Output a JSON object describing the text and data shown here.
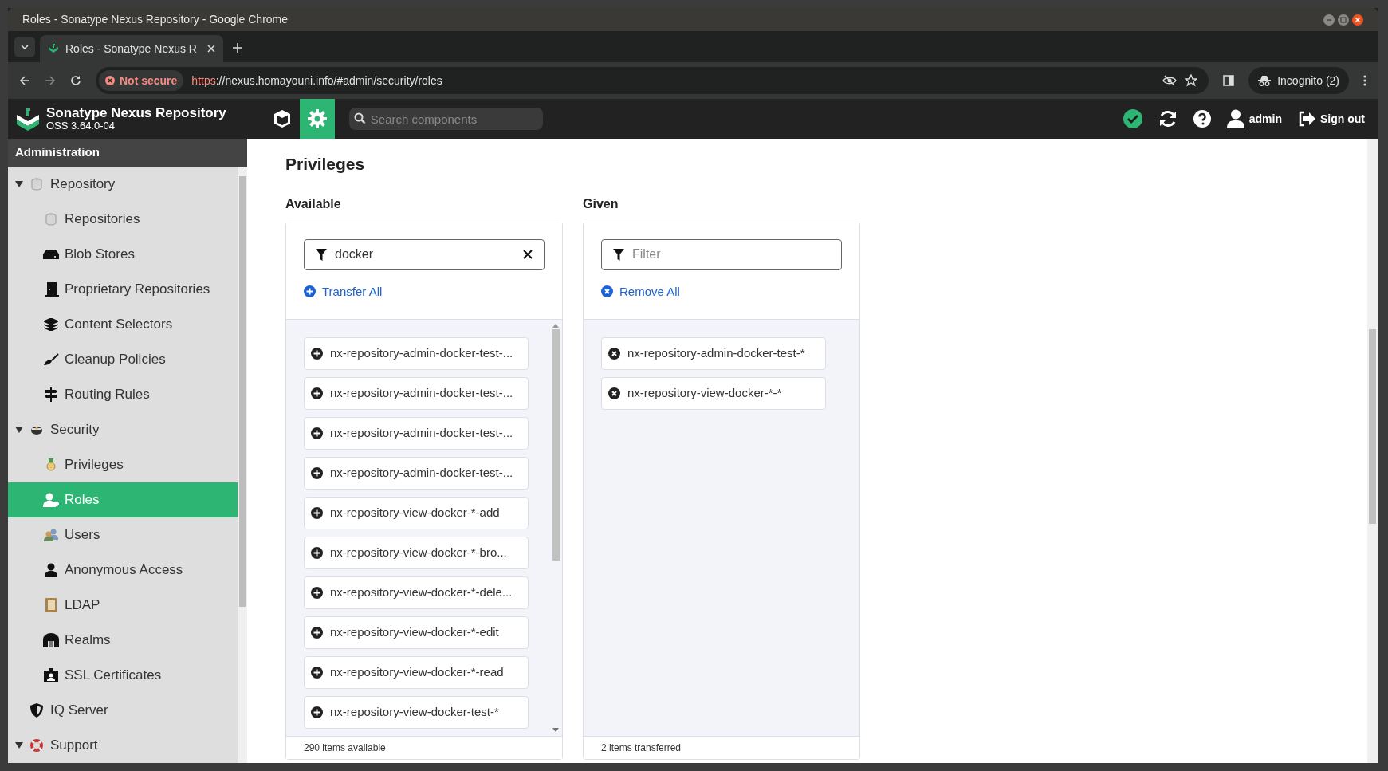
{
  "browser": {
    "window_title": "Roles - Sonatype Nexus Repository - Google Chrome",
    "tab_title": "Roles - Sonatype Nexus R",
    "security_label": "Not secure",
    "url_scheme": "https",
    "url_rest": "://nexus.homayouni.info/#admin/security/roles",
    "profile": "Incognito (2)"
  },
  "app": {
    "name": "Sonatype Nexus Repository",
    "version": "OSS 3.64.0-04",
    "modes": [
      {
        "selected": false
      },
      {
        "selected": true
      }
    ],
    "search": {
      "placeholder": "Search components"
    },
    "user": "admin",
    "sign_out": "Sign out"
  },
  "sidebar": {
    "title": "Administration",
    "items": [
      {
        "label": "Repository",
        "expanded": true,
        "selected": false,
        "children": [
          {
            "label": "Repositories",
            "selected": false
          },
          {
            "label": "Blob Stores",
            "selected": false
          },
          {
            "label": "Proprietary Repositories",
            "selected": false
          },
          {
            "label": "Content Selectors",
            "selected": false
          },
          {
            "label": "Cleanup Policies",
            "selected": false
          },
          {
            "label": "Routing Rules",
            "selected": false
          }
        ]
      },
      {
        "label": "Security",
        "expanded": true,
        "selected": false,
        "children": [
          {
            "label": "Privileges",
            "selected": false
          },
          {
            "label": "Roles",
            "selected": true
          },
          {
            "label": "Users",
            "selected": false
          },
          {
            "label": "Anonymous Access",
            "selected": false
          },
          {
            "label": "LDAP",
            "selected": false
          },
          {
            "label": "Realms",
            "selected": false
          },
          {
            "label": "SSL Certificates",
            "selected": false
          }
        ]
      },
      {
        "label": "IQ Server",
        "selected": false
      },
      {
        "label": "Support",
        "expanded": true,
        "selected": false
      }
    ]
  },
  "privileges": {
    "title": "Privileges",
    "available": {
      "label": "Available",
      "filter": {
        "value": "docker"
      },
      "action": "Transfer All",
      "items": [
        "nx-repository-admin-docker-test-...",
        "nx-repository-admin-docker-test-...",
        "nx-repository-admin-docker-test-...",
        "nx-repository-admin-docker-test-...",
        "nx-repository-view-docker-*-add",
        "nx-repository-view-docker-*-bro...",
        "nx-repository-view-docker-*-dele...",
        "nx-repository-view-docker-*-edit",
        "nx-repository-view-docker-*-read",
        "nx-repository-view-docker-test-*"
      ],
      "footer": "290 items available"
    },
    "given": {
      "label": "Given",
      "filter": {
        "placeholder": "Filter"
      },
      "action": "Remove All",
      "items": [
        "nx-repository-admin-docker-test-*",
        "nx-repository-view-docker-*-*"
      ],
      "footer": "2 items transferred"
    }
  }
}
